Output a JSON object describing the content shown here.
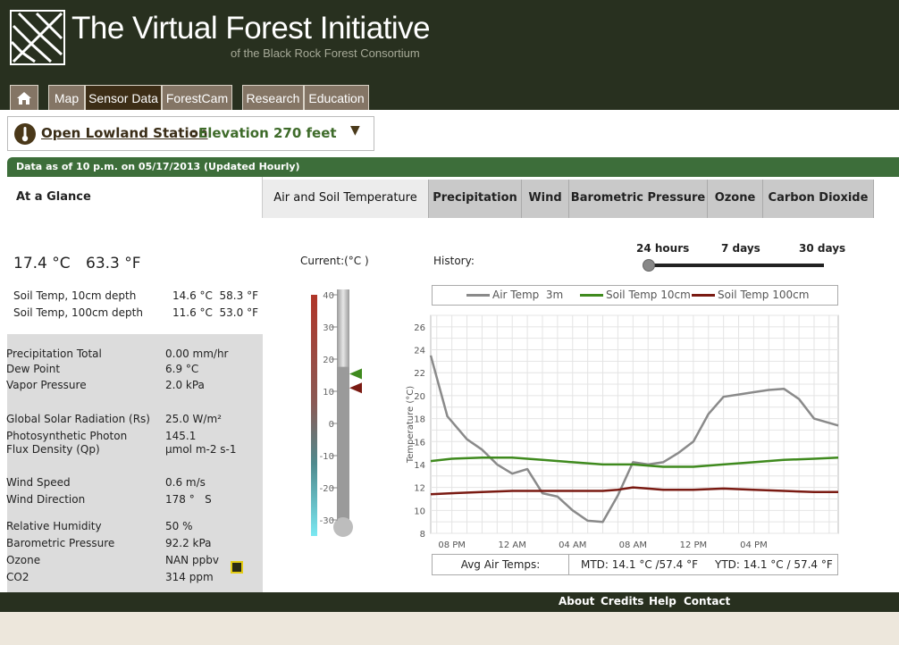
{
  "header": {
    "title": "The Virtual Forest Initiative",
    "subtitle": "of the Black Rock Forest Consortium"
  },
  "nav": {
    "home_icon": "home-icon",
    "tabs": [
      "Map",
      "Sensor Data",
      "ForestCam",
      "Research",
      "Education"
    ],
    "active": "Sensor Data"
  },
  "station": {
    "icon": "thermometer-icon",
    "name": "Open Lowland Station",
    "separator": ":",
    "elevation": "Elevation 270 feet",
    "dropdown_icon": "triangle-down-icon"
  },
  "status": "Data as of 10 p.m. on 05/17/2013 (Updated Hourly)",
  "tabs": {
    "glance": "At a Glance",
    "items": [
      "Air and Soil Temperature",
      "Precipitation",
      "Wind",
      "Barometric Pressure",
      "Ozone",
      "Carbon Dioxide"
    ],
    "active": "Air and Soil Temperature"
  },
  "readings": {
    "temp_c": "17.4 °C",
    "temp_f": "63.3 °F",
    "soil": [
      {
        "label": "Soil Temp, 10cm depth",
        "value": "14.6 °C  58.3 °F"
      },
      {
        "label": "Soil Temp, 100cm depth",
        "value": "11.6 °C  53.0 °F"
      }
    ],
    "params": [
      {
        "label": "Precipitation Total",
        "value": "0.00 mm/hr"
      },
      {
        "label": "Dew Point",
        "value": "6.9 °C"
      },
      {
        "label": "Vapor Pressure",
        "value": "2.0 kPa"
      },
      {
        "label": "Global Solar Radiation (Rs)",
        "value": "25.0 W/m²"
      },
      {
        "label": "Photosynthetic Photon",
        "value": "145.1"
      },
      {
        "label": "Flux Density (Qp)",
        "value": "µmol m-2 s-1"
      },
      {
        "label": "Wind Speed",
        "value": "0.6 m/s"
      },
      {
        "label": "Wind Direction",
        "value": "178 °   S"
      },
      {
        "label": "Relative Humidity",
        "value": "50 %"
      },
      {
        "label": "Barometric Pressure",
        "value": "92.2 kPa"
      },
      {
        "label": "Ozone",
        "value": "NAN ppbv"
      },
      {
        "label": "CO2",
        "value": "314 ppm"
      }
    ],
    "ozone_icon": "warning-icon"
  },
  "thermometer": {
    "label": "Current:(°C )",
    "ticks": [
      40,
      30,
      20,
      10,
      0,
      -10,
      -20,
      -30
    ],
    "markers": {
      "soil_temp_10cm": 14.6,
      "soil_temp_100cm": 11.6
    },
    "colors": {
      "soil_temp_10cm": "#3f8a1e",
      "soil_temp_100cm": "#7a1a12"
    }
  },
  "history": {
    "label": "History:",
    "ranges": [
      "24 hours",
      "7 days",
      "30 days"
    ],
    "selected_range": "24 hours"
  },
  "chart_data": {
    "type": "line",
    "title": "",
    "xlabel": "",
    "ylabel": "Temperature (°C)",
    "ylim": [
      8,
      27
    ],
    "yticks": [
      8,
      10,
      12,
      14,
      16,
      18,
      20,
      22,
      24,
      26
    ],
    "xlim": [
      -1.4,
      25.6
    ],
    "xticks": [
      {
        "x": 0,
        "label": "08 PM"
      },
      {
        "x": 4,
        "label": "12 AM"
      },
      {
        "x": 8,
        "label": "04 AM"
      },
      {
        "x": 12,
        "label": "08 AM"
      },
      {
        "x": 16,
        "label": "12 PM"
      },
      {
        "x": 20,
        "label": "04 PM"
      }
    ],
    "grid": true,
    "legend": "top",
    "series": [
      {
        "name": "Air Temp  3m",
        "color": "#8a8a8a",
        "x": [
          -1.4,
          -0.3,
          1,
          2,
          3,
          4,
          5,
          6,
          7,
          8,
          9,
          10,
          11,
          12,
          13,
          14,
          15,
          16,
          17,
          18,
          19,
          20,
          21,
          22,
          23,
          24,
          25.6
        ],
        "values": [
          23.5,
          18.2,
          16.2,
          15.3,
          14,
          13.2,
          13.6,
          11.5,
          11.2,
          10,
          9.1,
          9.0,
          11.3,
          14.2,
          14,
          14.2,
          15,
          16,
          18.4,
          19.9,
          20.1,
          20.3,
          20.5,
          20.6,
          19.7,
          18,
          17.4
        ]
      },
      {
        "name": "Soil Temp 10cm",
        "color": "#3f8a1e",
        "x": [
          -1.4,
          0,
          2,
          4,
          6,
          8,
          10,
          12,
          14,
          16,
          18,
          20,
          22,
          24,
          25.6
        ],
        "values": [
          14.3,
          14.5,
          14.6,
          14.6,
          14.4,
          14.2,
          14.0,
          14.0,
          13.8,
          13.8,
          14.0,
          14.2,
          14.4,
          14.5,
          14.6
        ]
      },
      {
        "name": "Soil Temp 100cm",
        "color": "#7a1a12",
        "x": [
          -1.4,
          0,
          2,
          4,
          6,
          8,
          10,
          11,
          12,
          13,
          14,
          16,
          18,
          20,
          22,
          24,
          25.6
        ],
        "values": [
          11.4,
          11.5,
          11.6,
          11.7,
          11.7,
          11.7,
          11.7,
          11.8,
          12.0,
          11.9,
          11.8,
          11.8,
          11.9,
          11.8,
          11.7,
          11.6,
          11.6
        ]
      }
    ]
  },
  "averages": {
    "label": "Avg Air Temps:",
    "mtd": "MTD: 14.1 °C /57.4 °F",
    "ytd": "YTD: 14.1 °C / 57.4 °F"
  },
  "footer": {
    "links": [
      "About",
      "Credits",
      "Help",
      "Contact"
    ]
  }
}
